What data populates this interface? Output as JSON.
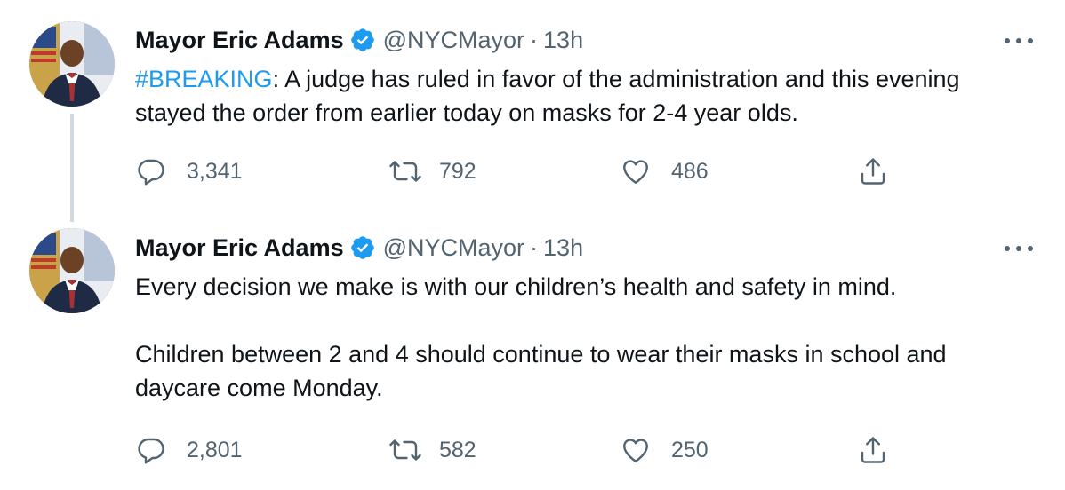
{
  "tweets": [
    {
      "author_name": "Mayor Eric Adams",
      "handle": "@NYCMayor",
      "separator": "·",
      "time": "13h",
      "hashtag": "#BREAKING",
      "text_after_hashtag": ": A judge has ruled in favor of the administration and this evening stayed the order from earlier today on masks for 2-4 year olds.",
      "replies": "3,341",
      "retweets": "792",
      "likes": "486"
    },
    {
      "author_name": "Mayor Eric Adams",
      "handle": "@NYCMayor",
      "separator": "·",
      "time": "13h",
      "paragraph_1": "Every decision we make is with our children’s health and safety in mind.",
      "paragraph_2": "Children between 2 and 4 should continue to wear their masks in school and daycare come Monday.",
      "replies": "2,801",
      "retweets": "582",
      "likes": "250"
    }
  ],
  "icons": {
    "verified": "verified-badge-icon",
    "more": "more-options-icon",
    "reply": "reply-icon",
    "retweet": "retweet-icon",
    "like": "heart-icon",
    "share": "share-icon"
  },
  "colors": {
    "text": "#0f1419",
    "secondary": "#536471",
    "accent": "#1d9bf0",
    "thread_line": "#cfd9de"
  }
}
